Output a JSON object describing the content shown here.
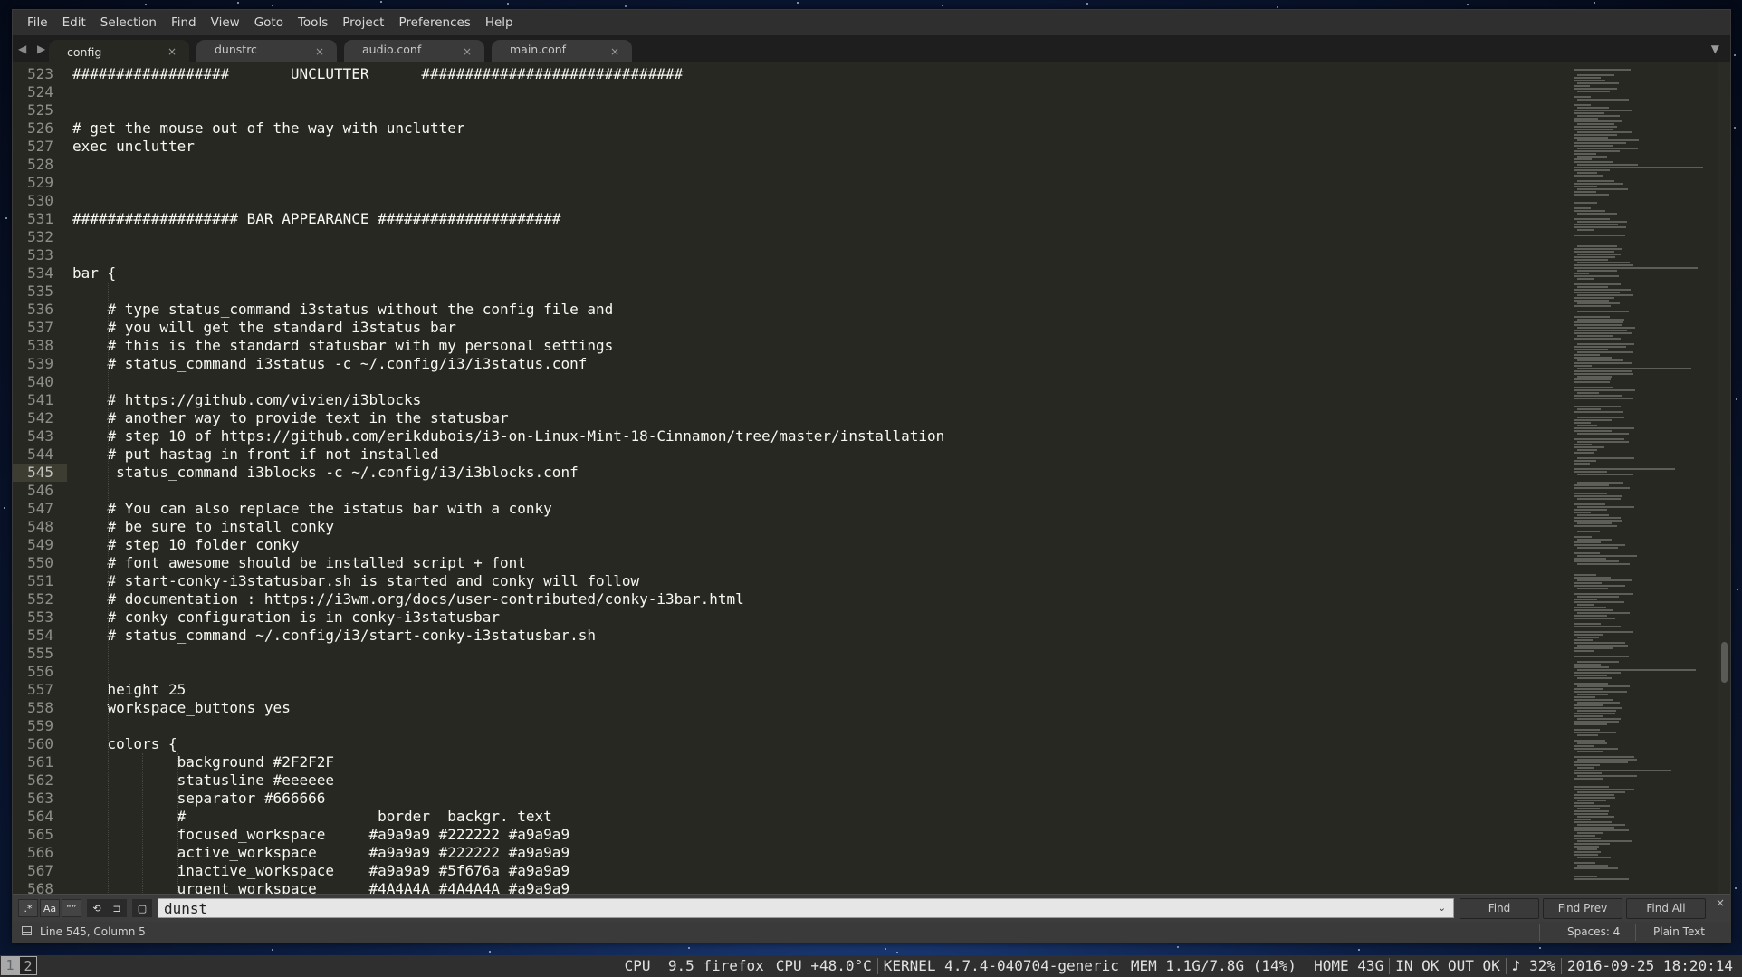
{
  "menubar": {
    "items": [
      "File",
      "Edit",
      "Selection",
      "Find",
      "View",
      "Goto",
      "Tools",
      "Project",
      "Preferences",
      "Help"
    ]
  },
  "tabs": [
    {
      "label": "config",
      "active": true
    },
    {
      "label": "dunstrc",
      "active": false
    },
    {
      "label": "audio.conf",
      "active": false
    },
    {
      "label": "main.conf",
      "active": false
    }
  ],
  "tab_close_glyph": "×",
  "tab_nav_glyph": "◀ ▶",
  "tab_dropdown_glyph": "▼",
  "editor": {
    "current_line": 545,
    "lines": [
      {
        "n": "523",
        "text": "##################       UNCLUTTER      ##############################"
      },
      {
        "n": "524",
        "text": ""
      },
      {
        "n": "525",
        "text": ""
      },
      {
        "n": "526",
        "text": "# get the mouse out of the way with unclutter"
      },
      {
        "n": "527",
        "text": "exec unclutter"
      },
      {
        "n": "528",
        "text": ""
      },
      {
        "n": "529",
        "text": ""
      },
      {
        "n": "530",
        "text": ""
      },
      {
        "n": "531",
        "text": "################### BAR APPEARANCE #####################"
      },
      {
        "n": "532",
        "text": ""
      },
      {
        "n": "533",
        "text": ""
      },
      {
        "n": "534",
        "text": "bar {"
      },
      {
        "n": "535",
        "text": ""
      },
      {
        "n": "536",
        "text": "    # type status_command i3status without the config file and"
      },
      {
        "n": "537",
        "text": "    # you will get the standard i3status bar"
      },
      {
        "n": "538",
        "text": "    # this is the standard statusbar with my personal settings"
      },
      {
        "n": "539",
        "text": "    # status_command i3status -c ~/.config/i3/i3status.conf"
      },
      {
        "n": "540",
        "text": ""
      },
      {
        "n": "541",
        "text": "    # https://github.com/vivien/i3blocks"
      },
      {
        "n": "542",
        "text": "    # another way to provide text in the statusbar"
      },
      {
        "n": "543",
        "text": "    # step 10 of https://github.com/erikdubois/i3-on-Linux-Mint-18-Cinnamon/tree/master/installation"
      },
      {
        "n": "544",
        "text": "    # put hastag in front if not installed"
      },
      {
        "n": "545",
        "text": "     status_command i3blocks -c ~/.config/i3/i3blocks.conf"
      },
      {
        "n": "546",
        "text": ""
      },
      {
        "n": "547",
        "text": "    # You can also replace the istatus bar with a conky"
      },
      {
        "n": "548",
        "text": "    # be sure to install conky"
      },
      {
        "n": "549",
        "text": "    # step 10 folder conky"
      },
      {
        "n": "550",
        "text": "    # font awesome should be installed script + font"
      },
      {
        "n": "551",
        "text": "    # start-conky-i3statusbar.sh is started and conky will follow"
      },
      {
        "n": "552",
        "text": "    # documentation : https://i3wm.org/docs/user-contributed/conky-i3bar.html"
      },
      {
        "n": "553",
        "text": "    # conky configuration is in conky-i3statusbar"
      },
      {
        "n": "554",
        "text": "    # status_command ~/.config/i3/start-conky-i3statusbar.sh"
      },
      {
        "n": "555",
        "text": ""
      },
      {
        "n": "556",
        "text": ""
      },
      {
        "n": "557",
        "text": "    height 25"
      },
      {
        "n": "558",
        "text": "    workspace_buttons yes"
      },
      {
        "n": "559",
        "text": ""
      },
      {
        "n": "560",
        "text": "    colors {"
      },
      {
        "n": "561",
        "text": "            background #2F2F2F"
      },
      {
        "n": "562",
        "text": "            statusline #eeeeee"
      },
      {
        "n": "563",
        "text": "            separator #666666"
      },
      {
        "n": "564",
        "text": "            #                      border  backgr. text"
      },
      {
        "n": "565",
        "text": "            focused_workspace     #a9a9a9 #222222 #a9a9a9"
      },
      {
        "n": "566",
        "text": "            active_workspace      #a9a9a9 #222222 #a9a9a9"
      },
      {
        "n": "567",
        "text": "            inactive_workspace    #a9a9a9 #5f676a #a9a9a9"
      },
      {
        "n": "568",
        "text": "            urgent_workspace      #4A4A4A #4A4A4A #a9a9a9"
      }
    ]
  },
  "findbar": {
    "options": [
      {
        "name": "regex",
        "label": ".*",
        "on": false
      },
      {
        "name": "case-sensitive",
        "label": "Aa",
        "on": false
      },
      {
        "name": "whole-word",
        "label": "“”",
        "on": false
      },
      {
        "name": "wrap",
        "label": "⟲",
        "on": true
      },
      {
        "name": "in-selection",
        "label": "⊐",
        "on": true
      },
      {
        "name": "highlight-matches",
        "label": "▢",
        "on": true
      }
    ],
    "query": "dunst",
    "history_glyph": "⌄",
    "find_label": "Find",
    "find_prev_label": "Find Prev",
    "find_all_label": "Find All",
    "close_glyph": "×"
  },
  "statusbar": {
    "position": "Line 545, Column 5",
    "spaces": "Spaces: 4",
    "syntax": "Plain Text"
  },
  "i3bar": {
    "workspaces": [
      "1",
      "2"
    ],
    "focused_workspace": "1",
    "items": [
      "CPU  9.5 firefox",
      "CPU +48.0°C",
      "KERNEL 4.7.4-040704-generic",
      "MEM 1.1G/7.8G (14%)  HOME 43G",
      "IN OK OUT OK",
      "♪ 32%",
      "2016-09-25 18:20:14"
    ]
  }
}
